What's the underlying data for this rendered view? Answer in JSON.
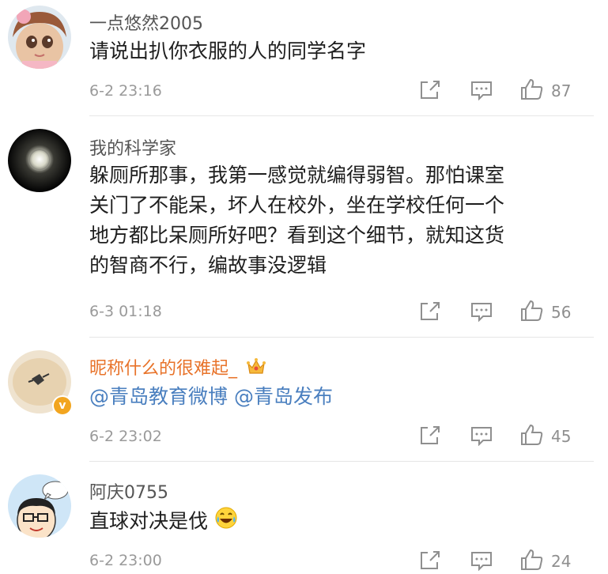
{
  "comments": [
    {
      "user": "一点悠然2005",
      "text": [
        "请说出扒你衣服的人的同学名字"
      ],
      "time": "6-2 23:16",
      "likes": "87"
    },
    {
      "user": "我的科学家",
      "text": [
        "躲厕所那事，我第一感觉就编得弱智。那怕课室",
        "关门了不能呆，坏人在校外，坐在学校任何一个",
        "地方都比呆厕所好吧？看到这个细节，就知这货",
        "的智商不行，编故事没逻辑"
      ],
      "time": "6-3 01:18",
      "likes": "56"
    },
    {
      "user": "昵称什么的很难起_",
      "mentions": [
        "@青岛教育微博",
        "@青岛发布"
      ],
      "time": "6-2 23:02",
      "likes": "45",
      "verified_badge": "v"
    },
    {
      "user": "阿庆0755",
      "text": [
        "直球对决是伐"
      ],
      "emoji": "laughing-tears-emoji",
      "time": "6-2 23:00",
      "likes": "24"
    }
  ],
  "icons": {
    "share": "share-icon",
    "comment": "comment-icon",
    "like": "thumbs-up-icon",
    "crown": "crown-badge-icon"
  },
  "colors": {
    "username": "#555555",
    "vip_username": "#e8732a",
    "mention": "#4a7fbf",
    "meta": "#9a9a9a",
    "verified": "#f2a51f"
  }
}
